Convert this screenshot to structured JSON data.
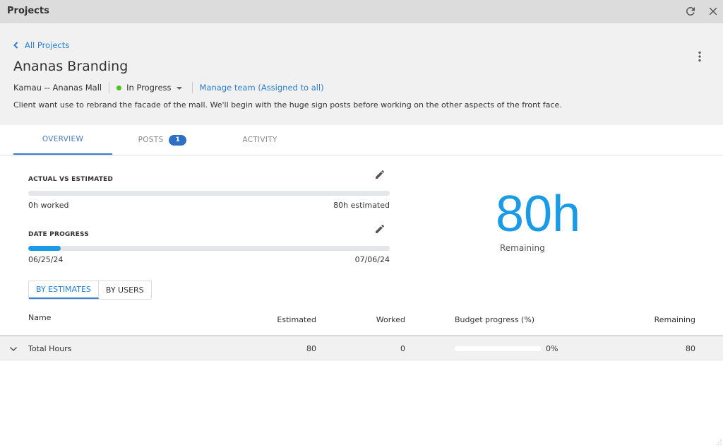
{
  "window": {
    "title": "Projects",
    "refresh_icon": "refresh-icon",
    "close_icon": "close-icon"
  },
  "header": {
    "back_label": "All Projects",
    "project_title": "Ananas Branding",
    "client": "Kamau -- Ananas Mall",
    "status": "In Progress",
    "status_color": "#4cc21f",
    "manage_team_label": "Manage team (Assigned to all)",
    "description": "Client want use to rebrand the facade of the mall. We'll begin with the huge sign posts before working on the other aspects of the front face."
  },
  "tabs": [
    {
      "label": "OVERVIEW",
      "active": true
    },
    {
      "label": "POSTS",
      "badge": "1"
    },
    {
      "label": "ACTIVITY"
    }
  ],
  "overview": {
    "actual_vs_estimated": {
      "label": "ACTUAL VS ESTIMATED",
      "worked_text": "0h worked",
      "estimated_text": "80h estimated",
      "progress": 0
    },
    "date_progress": {
      "label": "DATE PROGRESS",
      "start_date": "06/25/24",
      "end_date": "07/06/24",
      "progress": 0.09
    },
    "remaining": {
      "value": "80h",
      "label": "Remaining"
    },
    "view_toggle": {
      "by_estimates": "BY ESTIMATES",
      "by_users": "BY USERS",
      "selected": "BY ESTIMATES"
    }
  },
  "table": {
    "headers": {
      "name": "Name",
      "estimated": "Estimated",
      "worked": "Worked",
      "budget_progress": "Budget progress (%)",
      "remaining": "Remaining"
    },
    "rows": [
      {
        "name": "Total Hours",
        "estimated": "80",
        "worked": "0",
        "budget_progress": "0%",
        "remaining": "80"
      }
    ]
  },
  "colors": {
    "accent": "#1a9be6",
    "link": "#2a7fd0",
    "badge": "#2d6fc4"
  }
}
